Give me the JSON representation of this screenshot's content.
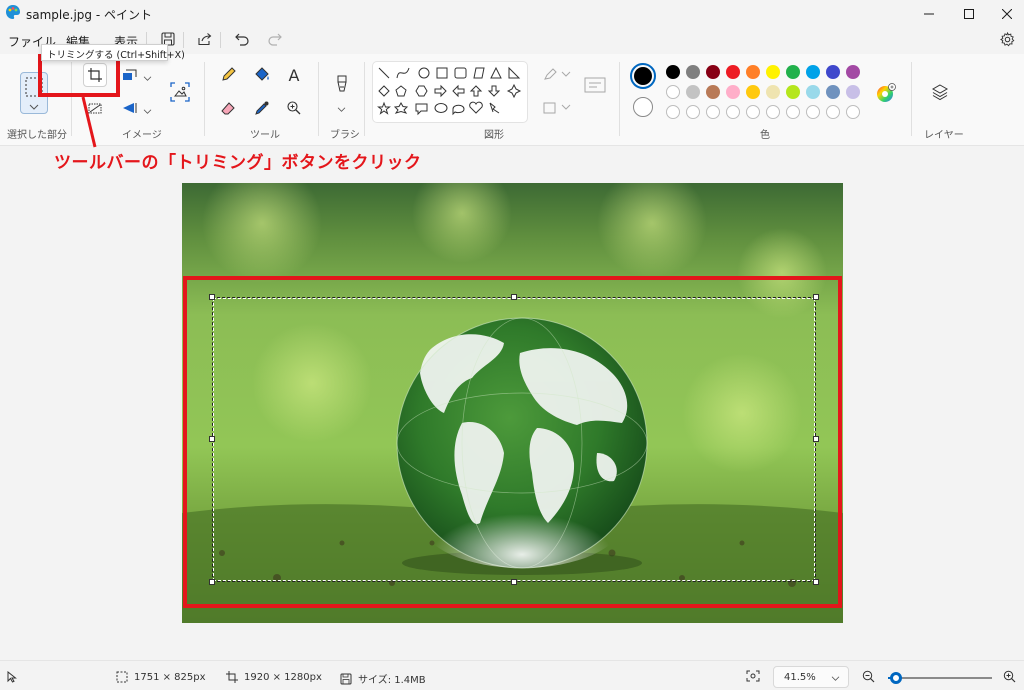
{
  "window": {
    "title": "sample.jpg - ペイント"
  },
  "menu": {
    "file": "ファイル",
    "edit": "編集",
    "view": "表示"
  },
  "ribbon": {
    "groups": {
      "selection": "選択した部分",
      "image": "イメージ",
      "tools": "ツール",
      "brush": "ブラシ",
      "shapes": "図形",
      "colors": "色",
      "layers": "レイヤー"
    },
    "tools_text_glyph": "A",
    "colors": {
      "primary": "#000000",
      "secondary": "#ffffff",
      "row1": [
        "#000000",
        "#7f7f7f",
        "#880015",
        "#ed1c24",
        "#ff7f27",
        "#fff200",
        "#22b14c",
        "#00a2e8",
        "#3f48cc",
        "#a349a4"
      ],
      "row2": [
        "#ffffff",
        "#c3c3c3",
        "#b97a57",
        "#ffaec9",
        "#ffc90e",
        "#efe4b0",
        "#b5e61d",
        "#99d9ea",
        "#7092be",
        "#c8bfe7"
      ]
    }
  },
  "tooltip": {
    "text": "トリミングする (Ctrl+Shift+X)"
  },
  "annotation": {
    "text": "ツールバーの「トリミング」ボタンをクリック",
    "color": "#e4161b"
  },
  "status": {
    "selection_size": "1751 × 825px",
    "image_size": "1920 × 1280px",
    "file_size": "サイズ: 1.4MB",
    "zoom": "41.5%",
    "zoom_level": 0.08
  }
}
